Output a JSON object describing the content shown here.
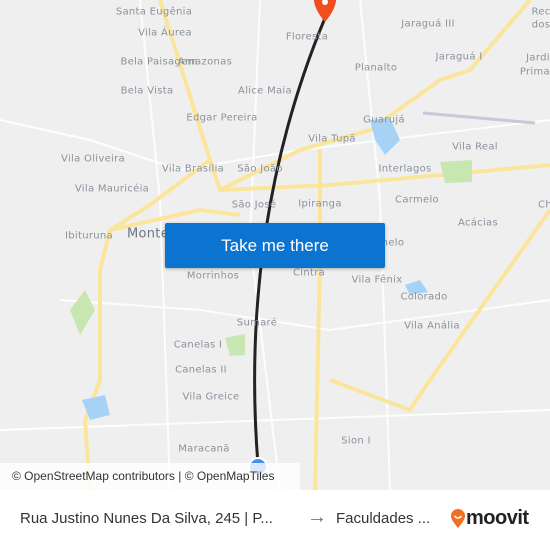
{
  "map": {
    "labels": [
      [
        "Santa Eugênia",
        154,
        12
      ],
      [
        "Vila Áurea",
        165,
        33
      ],
      [
        "Bela Paisagem",
        159,
        62
      ],
      [
        "Amazonas",
        205,
        62
      ],
      [
        "Alice Maia",
        265,
        91
      ],
      [
        "Bela Vista",
        147,
        91
      ],
      [
        "Edgar Pereira",
        222,
        118
      ],
      [
        "Floresta",
        307,
        37
      ],
      [
        "Jaraguá III",
        428,
        24
      ],
      [
        "Jaraguá I",
        459,
        57
      ],
      [
        "Planalto",
        376,
        68
      ],
      [
        "Guarujá",
        384,
        120
      ],
      [
        "Vila Tupã",
        332,
        139
      ],
      [
        "Vila Real",
        475,
        147
      ],
      [
        "Interlagos",
        405,
        169
      ],
      [
        "Vila Oliveira",
        93,
        159
      ],
      [
        "Vila Brasília",
        193,
        169
      ],
      [
        "São João",
        260,
        169
      ],
      [
        "Vila Mauricéia",
        112,
        189
      ],
      [
        "São José",
        254,
        205
      ],
      [
        "Ipiranga",
        320,
        204
      ],
      [
        "Carmelo",
        417,
        200
      ],
      [
        "Acácias",
        478,
        223
      ],
      [
        "Ibituruna",
        89,
        236
      ],
      [
        "Morrinhos",
        213,
        276
      ],
      [
        "Cintra",
        309,
        273
      ],
      [
        "Vila Fênix",
        377,
        280
      ],
      [
        "Colorado",
        424,
        297
      ],
      [
        "Sumaré",
        257,
        323
      ],
      [
        "Vila Anália",
        432,
        326
      ],
      [
        "Canelas I",
        198,
        345
      ],
      [
        "Canelas II",
        201,
        370
      ],
      [
        "Vila Greice",
        211,
        397
      ],
      [
        "Maracanã",
        204,
        449
      ],
      [
        "Sion I",
        356,
        441
      ],
      [
        "Rec",
        541,
        12
      ],
      [
        "dos",
        541,
        25
      ],
      [
        "Jardi",
        538,
        58
      ],
      [
        "Primav",
        538,
        72
      ],
      [
        "Ch",
        545,
        205
      ],
      [
        "nelo",
        393,
        243
      ]
    ],
    "city_label": "Monte",
    "colors": {
      "road": "#fbe59b",
      "route": "#222222",
      "water": "#a6d3f5",
      "park": "#c8e6b0",
      "origin": "#4a8ef0",
      "dest": "#f04e1c"
    }
  },
  "cta": {
    "label": "Take me there"
  },
  "attribution": "© OpenStreetMap contributors | © OpenMapTiles",
  "footer": {
    "from": "Rua Justino Nunes Da Silva, 245 | P...",
    "arrow": "→",
    "to": "Faculdades ...",
    "brand": "moovit"
  }
}
